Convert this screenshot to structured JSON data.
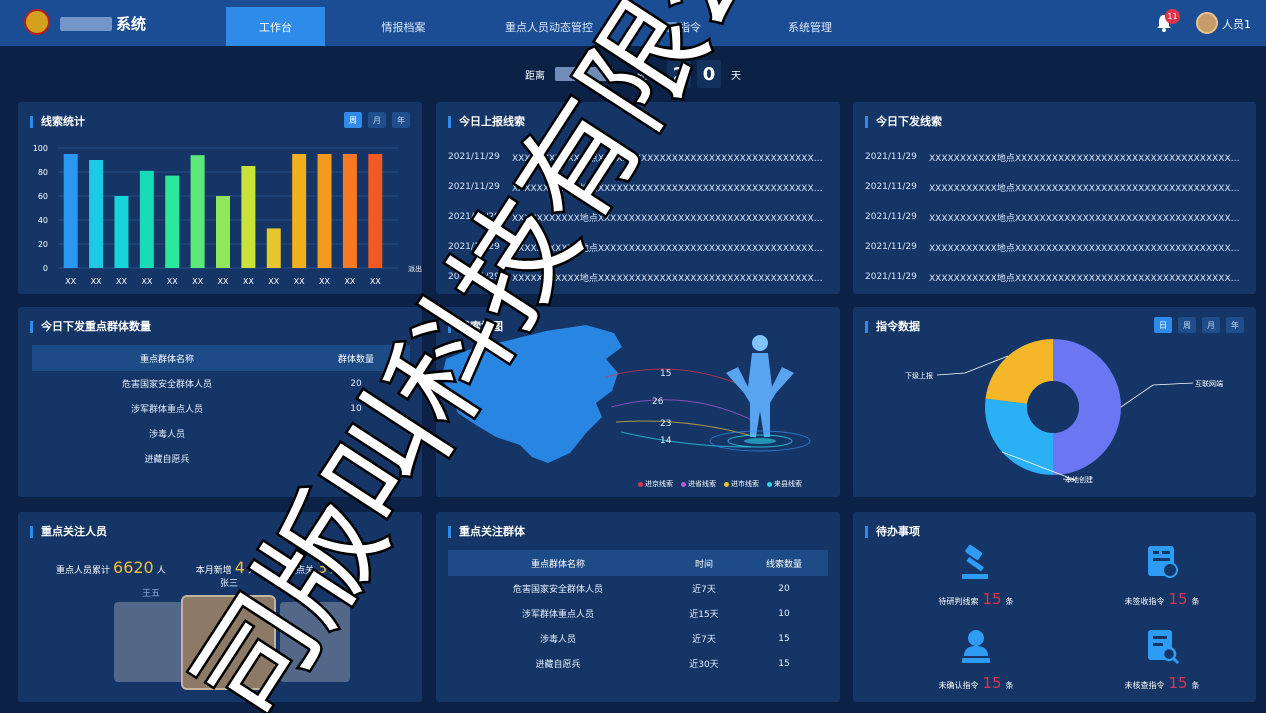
{
  "header": {
    "app_title": "系统",
    "nav": [
      "工作台",
      "情报档案",
      "重点人员动态管控",
      "指令",
      "系统管理"
    ],
    "active_nav": 0,
    "notification_count": "11",
    "user_name": "人员1"
  },
  "countdown": {
    "prefix": "距离",
    "middle": "还有",
    "digits": [
      "2",
      "0"
    ],
    "unit": "天"
  },
  "clue_stats": {
    "title": "线索统计",
    "periods": [
      "周",
      "月",
      "年"
    ],
    "active_period": 0,
    "chart_data": {
      "type": "bar",
      "categories": [
        "XX",
        "XX",
        "XX",
        "XX",
        "XX",
        "XX",
        "XX",
        "XX",
        "XX",
        "XX",
        "XX",
        "XX",
        "XX"
      ],
      "values": [
        95,
        90,
        60,
        81,
        77,
        94,
        60,
        85,
        33,
        95,
        95,
        95,
        95
      ],
      "colors": [
        "#2a97f2",
        "#1fc9e6",
        "#18d4d8",
        "#18dcb8",
        "#2be89a",
        "#5de97a",
        "#8fe85c",
        "#c8e23a",
        "#e6c62a",
        "#f2b020",
        "#f49a1e",
        "#f57a22",
        "#f25a24"
      ],
      "ylim": [
        0,
        100
      ],
      "yticks": [
        0,
        20,
        40,
        60,
        80,
        100
      ],
      "xlabel": "派出所",
      "ylabel": "",
      "title": "",
      "grid": true
    }
  },
  "reported_today": {
    "title": "今日上报线索",
    "rows": [
      {
        "date": "2021/11/29",
        "text": "XXXXXXXXXXX地点XXXXXXXXXXXXXXXXXXXXXXXXXXXXXXXXXXXXXXXX..."
      },
      {
        "date": "2021/11/29",
        "text": "XXXXXXXXXXX地点XXXXXXXXXXXXXXXXXXXXXXXXXXXXXXXXXXXXXXXX..."
      },
      {
        "date": "2021/11/29",
        "text": "XXXXXXXXXXX地点XXXXXXXXXXXXXXXXXXXXXXXXXXXXXXXXXXXXXXXX..."
      },
      {
        "date": "2021/11/29",
        "text": "XXXXXXXXXXX地点XXXXXXXXXXXXXXXXXXXXXXXXXXXXXXXXXXXXXXXX..."
      },
      {
        "date": "2021/11/29",
        "text": "XXXXXXXXXXX地点XXXXXXXXXXXXXXXXXXXXXXXXXXXXXXXXXXXXXXXX..."
      }
    ]
  },
  "issued_today": {
    "title": "今日下发线索",
    "rows": [
      {
        "date": "2021/11/29",
        "text": "XXXXXXXXXXX地点XXXXXXXXXXXXXXXXXXXXXXXXXXXXXXXXXXXXXXXX..."
      },
      {
        "date": "2021/11/29",
        "text": "XXXXXXXXXXX地点XXXXXXXXXXXXXXXXXXXXXXXXXXXXXXXXXXXXXXXX..."
      },
      {
        "date": "2021/11/29",
        "text": "XXXXXXXXXXX地点XXXXXXXXXXXXXXXXXXXXXXXXXXXXXXXXXXXXXXXX..."
      },
      {
        "date": "2021/11/29",
        "text": "XXXXXXXXXXX地点XXXXXXXXXXXXXXXXXXXXXXXXXXXXXXXXXXXXXXXX..."
      },
      {
        "date": "2021/11/29",
        "text": "XXXXXXXXXXX地点XXXXXXXXXXXXXXXXXXXXXXXXXXXXXXXXXXXXXXXX..."
      }
    ]
  },
  "group_issued": {
    "title": "今日下发重点群体数量",
    "headers": [
      "重点群体名称",
      "群体数量"
    ],
    "rows": [
      [
        "危害国家安全群体人员",
        "20"
      ],
      [
        "涉军群体重点人员",
        "10"
      ],
      [
        "涉毒人员",
        "15"
      ],
      [
        "进藏自愿兵",
        "15"
      ]
    ]
  },
  "clue_map": {
    "title": "线索地图",
    "numbers": [
      "15",
      "26",
      "23",
      "14"
    ],
    "legend": [
      {
        "label": "进京线索",
        "color": "#e0334a"
      },
      {
        "label": "进省线索",
        "color": "#b55ad8"
      },
      {
        "label": "进市线索",
        "color": "#f0c030"
      },
      {
        "label": "来县线索",
        "color": "#2fd4e8"
      }
    ]
  },
  "command_data": {
    "title": "指令数据",
    "periods": [
      "日",
      "周",
      "月",
      "年"
    ],
    "active_period": 0,
    "chart_data": {
      "type": "pie",
      "labels": [
        "互联网端",
        "本地创建",
        "下级上报"
      ],
      "values": [
        50,
        27,
        23
      ],
      "colors": [
        "#6b76f2",
        "#29b0f5",
        "#f5b72a"
      ]
    }
  },
  "key_persons": {
    "title": "重点关注人员",
    "stats": [
      {
        "label": "重点人员累计",
        "value": "6620",
        "unit": "人"
      },
      {
        "label": "本月新增",
        "value": "4",
        "unit": "人"
      },
      {
        "label": "重点关",
        "value": "3",
        "unit": "人"
      }
    ],
    "people": [
      "王五",
      "张三",
      "李四"
    ]
  },
  "key_groups": {
    "title": "重点关注群体",
    "headers": [
      "重点群体名称",
      "时间",
      "线索数量"
    ],
    "rows": [
      [
        "危害国家安全群体人员",
        "近7天",
        "20"
      ],
      [
        "涉军群体重点人员",
        "近15天",
        "10"
      ],
      [
        "涉毒人员",
        "近7天",
        "15"
      ],
      [
        "进藏自愿兵",
        "近30天",
        "15"
      ]
    ]
  },
  "todo": {
    "title": "待办事项",
    "items": [
      {
        "label": "待研判线索",
        "count": "15",
        "unit": "条",
        "icon": "gavel-icon"
      },
      {
        "label": "未签收指令",
        "count": "15",
        "unit": "条",
        "icon": "inbox-document-icon"
      },
      {
        "label": "未确认指令",
        "count": "15",
        "unit": "条",
        "icon": "person-stamp-icon"
      },
      {
        "label": "未核查指令",
        "count": "15",
        "unit": "条",
        "icon": "document-search-icon"
      }
    ]
  },
  "watermark": {
    "text": "司版叫科技有限公司"
  }
}
